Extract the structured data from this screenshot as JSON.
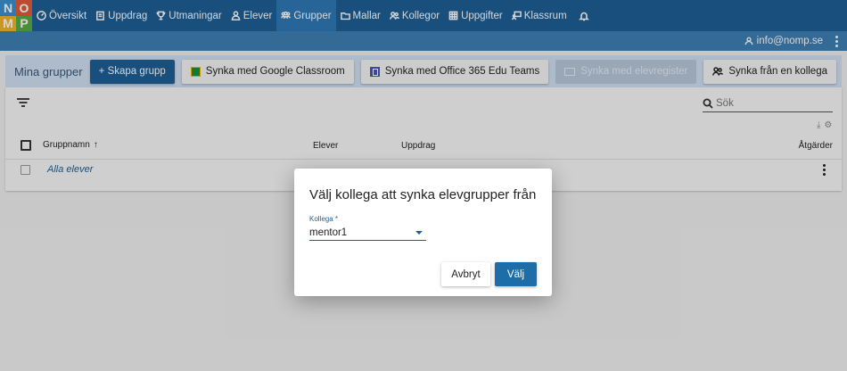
{
  "logo": {
    "letters": [
      "N",
      "O",
      "M",
      "P"
    ]
  },
  "nav": {
    "items": [
      {
        "label": "Översikt",
        "icon": "speedometer-icon",
        "active": false
      },
      {
        "label": "Uppdrag",
        "icon": "clipboard-icon",
        "active": false
      },
      {
        "label": "Utmaningar",
        "icon": "trophy-icon",
        "active": false
      },
      {
        "label": "Elever",
        "icon": "person-icon",
        "active": false
      },
      {
        "label": "Grupper",
        "icon": "group-icon",
        "active": true
      },
      {
        "label": "Mallar",
        "icon": "folder-icon",
        "active": false
      },
      {
        "label": "Kollegor",
        "icon": "people-icon",
        "active": false
      },
      {
        "label": "Uppgifter",
        "icon": "grid-icon",
        "active": false
      },
      {
        "label": "Klassrum",
        "icon": "classroom-icon",
        "active": false
      }
    ],
    "bell_icon": "bell-icon"
  },
  "user": {
    "email": "info@nomp.se"
  },
  "toolbar": {
    "title": "Mina grupper",
    "create_label": "+ Skapa grupp",
    "google_label": "Synka med Google Classroom",
    "office_label": "Synka med Office 365 Edu Teams",
    "register_label": "Synka med elevregister",
    "colleague_label": "Synka från en kollega"
  },
  "search": {
    "placeholder": "Sök"
  },
  "table": {
    "columns": [
      "Gruppnamn",
      "Elever",
      "Uppdrag",
      "Åtgärder"
    ],
    "rows": [
      {
        "name": "Alla elever"
      }
    ]
  },
  "dialog": {
    "title": "Välj kollega att synka elevgrupper från",
    "field_label": "Kollega *",
    "selected": "mentor1",
    "cancel_label": "Avbryt",
    "confirm_label": "Välj"
  },
  "colors": {
    "nav_bg": "#1d5f96",
    "accent": "#1d6ea8",
    "toolbar_bg": "#cfdff1"
  }
}
